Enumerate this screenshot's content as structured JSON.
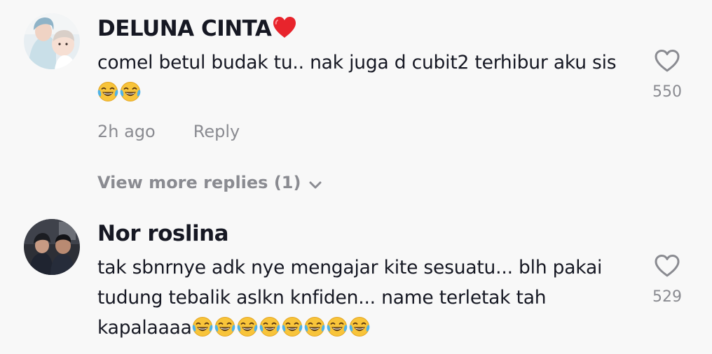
{
  "comments": [
    {
      "username": "DELUNA CINTA",
      "username_emoji": "red-heart",
      "text": "comel betul budak tu.. nak juga d cubit2 terhibur aku sis ",
      "text_emojis": [
        "face-with-tears-of-joy",
        "face-with-tears-of-joy"
      ],
      "timestamp": "2h ago",
      "reply_label": "Reply",
      "likes": "550",
      "view_more": "View more replies (1)"
    },
    {
      "username": "Nor roslina",
      "text": "tak sbnrnye adk nye mengajar kite sesuatu... blh pakai tudung tebalik aslkn knfiden... name terletak tah kapalaaaa",
      "text_emojis": [
        "face-with-tears-of-joy",
        "face-with-tears-of-joy",
        "face-with-tears-of-joy",
        "face-with-tears-of-joy",
        "face-with-tears-of-joy",
        "face-with-tears-of-joy",
        "face-with-tears-of-joy",
        "face-with-tears-of-joy"
      ],
      "likes": "529"
    }
  ],
  "colors": {
    "background": "#f8f8f8",
    "primary_text": "#161823",
    "secondary_text": "#8a8b91",
    "heart_emoji": "#e8242c"
  }
}
